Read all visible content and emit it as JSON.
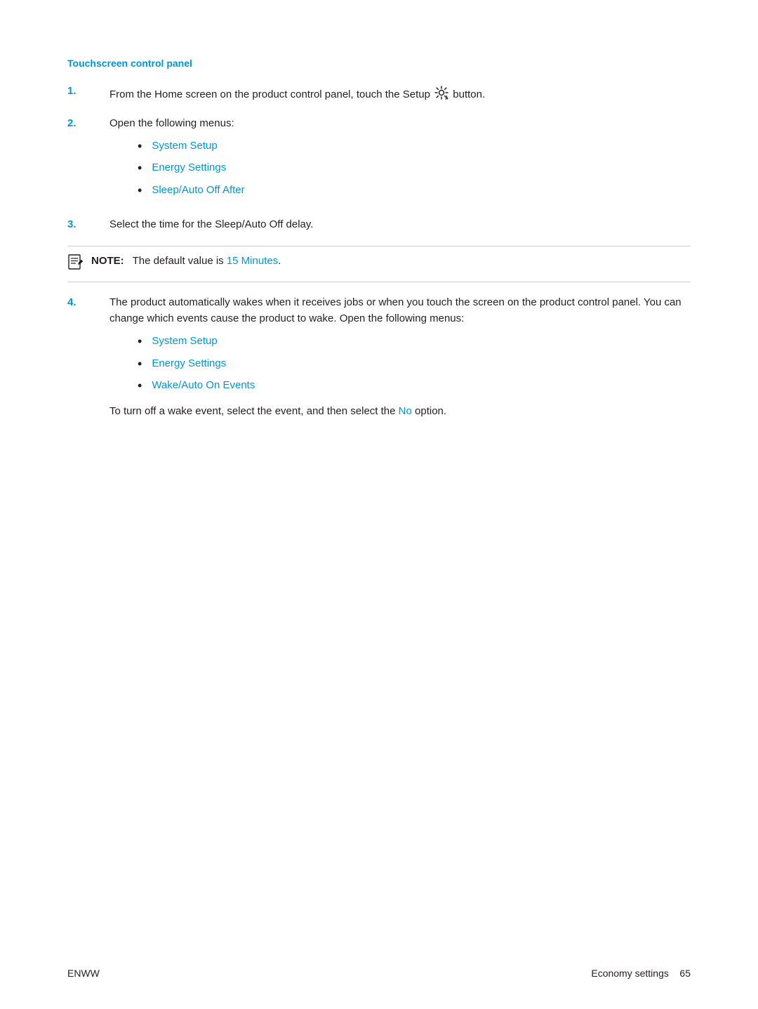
{
  "page": {
    "title": "Touchscreen control panel",
    "steps": [
      {
        "number": "1.",
        "text_before": "From the Home screen on the product control panel, touch the Setup ",
        "has_icon": true,
        "text_after": " button."
      },
      {
        "number": "2.",
        "text": "Open the following menus:",
        "sub_items": [
          {
            "label": "System Setup",
            "color": "#0096d6"
          },
          {
            "label": "Energy Settings",
            "color": "#0096d6"
          },
          {
            "label": "Sleep/Auto Off After",
            "color": "#0096d6"
          }
        ]
      },
      {
        "number": "3.",
        "text": "Select the time for the Sleep/Auto Off delay."
      }
    ],
    "note": {
      "label": "NOTE:",
      "text_before": "The default value is ",
      "highlight": "15 Minutes",
      "text_after": ".",
      "highlight_color": "#0096d6"
    },
    "step4": {
      "number": "4.",
      "text": "The product automatically wakes when it receives jobs or when you touch the screen on the product control panel. You can change which events cause the product to wake. Open the following menus:",
      "sub_items": [
        {
          "label": "System Setup",
          "color": "#0096d6"
        },
        {
          "label": "Energy Settings",
          "color": "#0096d6"
        },
        {
          "label": "Wake/Auto On Events",
          "color": "#0096d6"
        }
      ],
      "footer_text_before": "To turn off a wake event, select the event, and then select the ",
      "footer_highlight": "No",
      "footer_highlight_color": "#0096d6",
      "footer_text_after": " option."
    },
    "footer": {
      "left": "ENWW",
      "right_text": "Economy settings",
      "page_number": "65"
    }
  }
}
